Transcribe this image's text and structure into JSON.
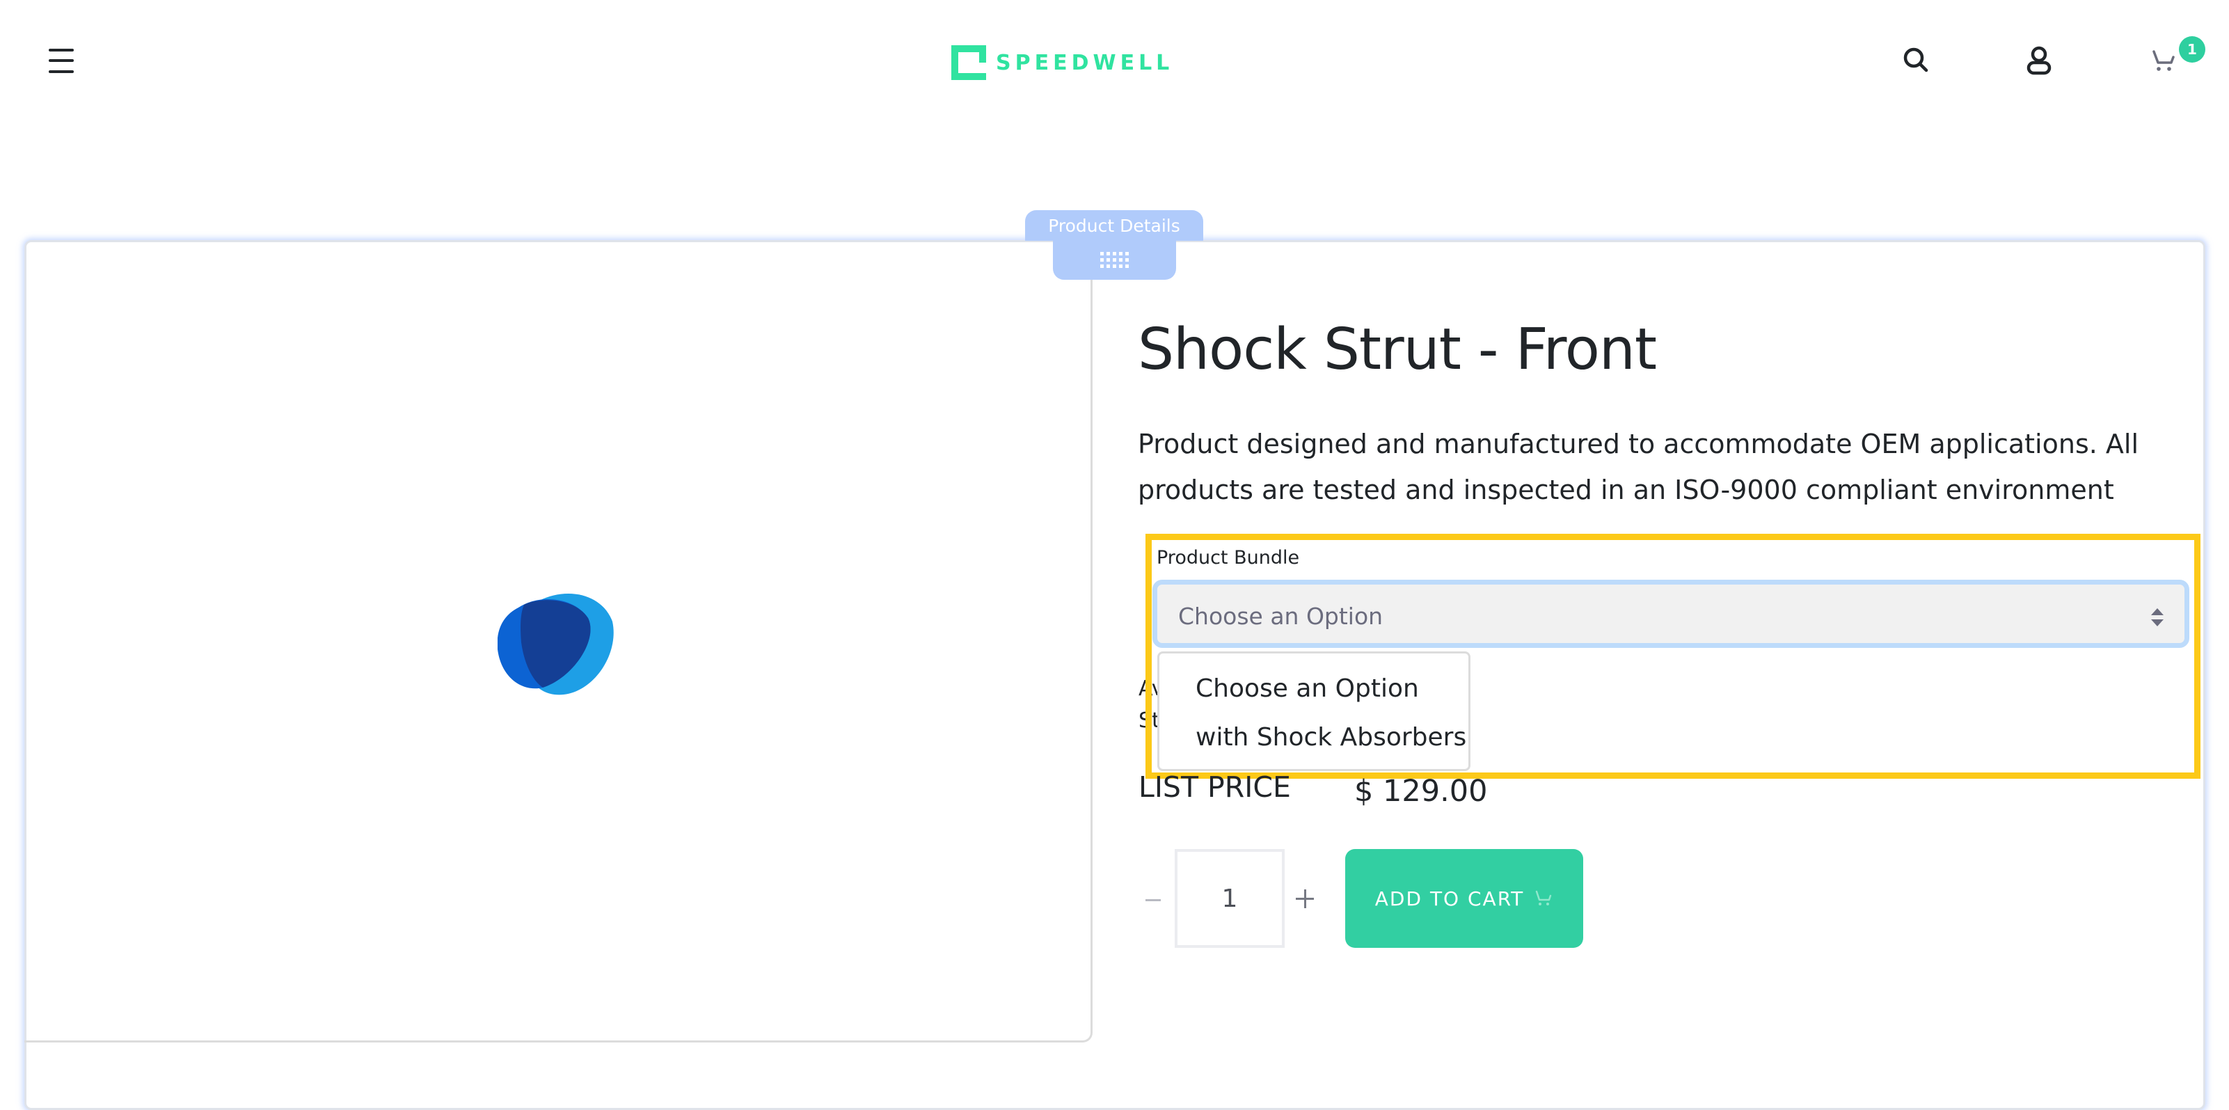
{
  "header": {
    "brand": "SPEEDWELL",
    "cart_count": "1"
  },
  "section": {
    "tab_label": "Product Details"
  },
  "product": {
    "title": "Shock Strut - Front",
    "description": "Product designed and manufactured to accommodate OEM applications. All products are tested and inspected in an ISO-9000 compliant environment",
    "bundle_label": "Product Bundle",
    "bundle_selected": "Choose an Option",
    "bundle_options": [
      "Choose an Option",
      "with Shock Absorbers"
    ],
    "availability_partial_line1": "Av",
    "availability_partial_line2": "St",
    "list_price_label": "LIST PRICE",
    "list_price_value": "$ 129.00",
    "quantity": "1",
    "add_to_cart_label": "ADD TO CART"
  },
  "colors": {
    "brand": "#30e3a0",
    "button": "#32cfa2",
    "highlight": "#fcc918",
    "tab": "#b0cbfb"
  }
}
